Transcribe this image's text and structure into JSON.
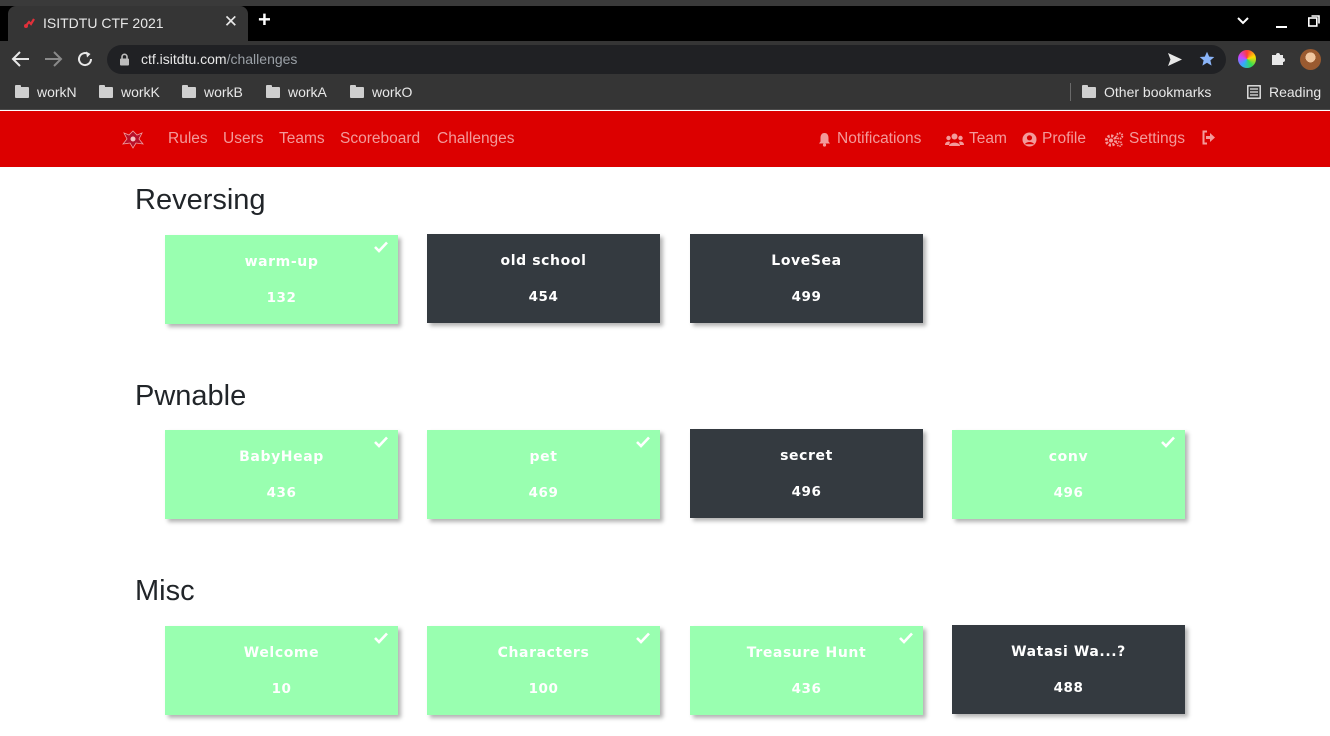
{
  "browser": {
    "tab_title": "ISITDTU CTF 2021",
    "tab_close": "✕",
    "new_tab": "+",
    "url_host": "ctf.isitdtu.com",
    "url_path": "/challenges",
    "bookmarks": [
      "workN",
      "workK",
      "workB",
      "workA",
      "workO"
    ],
    "other_bookmarks": "Other bookmarks",
    "reading_list": "Reading"
  },
  "nav": {
    "left": [
      "Rules",
      "Users",
      "Teams",
      "Scoreboard",
      "Challenges"
    ],
    "notifications": "Notifications",
    "team": "Team",
    "profile": "Profile",
    "settings": "Settings"
  },
  "categories": [
    {
      "name": "Reversing",
      "challenges": [
        {
          "name": "warm-up",
          "value": "132",
          "solved": true
        },
        {
          "name": "old school",
          "value": "454",
          "solved": false
        },
        {
          "name": "LoveSea",
          "value": "499",
          "solved": false
        }
      ]
    },
    {
      "name": "Pwnable",
      "challenges": [
        {
          "name": "BabyHeap",
          "value": "436",
          "solved": true
        },
        {
          "name": "pet",
          "value": "469",
          "solved": true
        },
        {
          "name": "secret",
          "value": "496",
          "solved": false
        },
        {
          "name": "conv",
          "value": "496",
          "solved": true
        }
      ]
    },
    {
      "name": "Misc",
      "challenges": [
        {
          "name": "Welcome",
          "value": "10",
          "solved": true
        },
        {
          "name": "Characters",
          "value": "100",
          "solved": true
        },
        {
          "name": "Treasure Hunt",
          "value": "436",
          "solved": true
        },
        {
          "name": "Watasi Wa...?",
          "value": "488",
          "solved": false
        }
      ]
    }
  ],
  "colors": {
    "navbar": "#dc0000",
    "solved": "#99ffb0",
    "unsolved": "#343a40"
  }
}
